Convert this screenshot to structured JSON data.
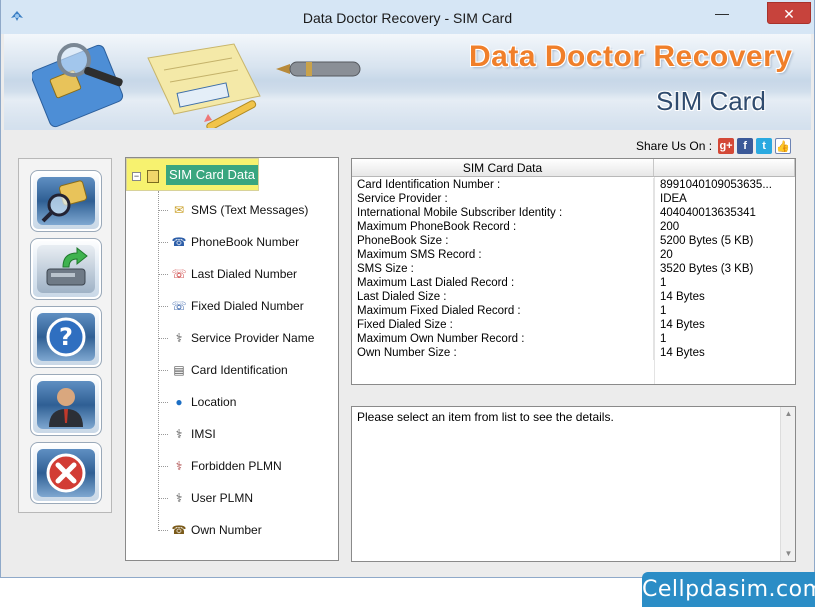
{
  "window": {
    "title": "Data Doctor Recovery - SIM Card",
    "min_glyph": "—",
    "close_glyph": "✕"
  },
  "banner": {
    "title": "Data Doctor Recovery",
    "subtitle": "SIM Card"
  },
  "share": {
    "label": "Share Us On :",
    "google": "g+",
    "facebook": "f",
    "twitter": "t",
    "like": "👍"
  },
  "sidebar": {
    "buttons": [
      {
        "icon": "search-sim-icon"
      },
      {
        "icon": "save-drive-icon"
      },
      {
        "icon": "help-icon"
      },
      {
        "icon": "user-icon"
      },
      {
        "icon": "exit-icon"
      }
    ]
  },
  "tree": {
    "root": "SIM Card Data",
    "items": [
      {
        "label": "SMS (Text Messages)",
        "icon": "envelope-icon",
        "glyph": "✉",
        "color": "#c79a1b"
      },
      {
        "label": "PhoneBook Number",
        "icon": "phonebook-icon",
        "glyph": "☎",
        "color": "#2d5ea8"
      },
      {
        "label": "Last Dialed Number",
        "icon": "phone-red-icon",
        "glyph": "☏",
        "color": "#c62828"
      },
      {
        "label": "Fixed Dialed Number",
        "icon": "phone-fixed-icon",
        "glyph": "☏",
        "color": "#1e4fa0"
      },
      {
        "label": "Service Provider Name",
        "icon": "tower-icon",
        "glyph": "⚕",
        "color": "#444444"
      },
      {
        "label": "Card Identification",
        "icon": "id-card-icon",
        "glyph": "▤",
        "color": "#555555"
      },
      {
        "label": "Location",
        "icon": "globe-icon",
        "glyph": "●",
        "color": "#1d6fc4"
      },
      {
        "label": "IMSI",
        "icon": "antenna-icon",
        "glyph": "⚕",
        "color": "#444444"
      },
      {
        "label": "Forbidden PLMN",
        "icon": "antenna-forbidden-icon",
        "glyph": "⚕",
        "color": "#a33333"
      },
      {
        "label": "User PLMN",
        "icon": "antenna-user-icon",
        "glyph": "⚕",
        "color": "#444444"
      },
      {
        "label": "Own Number",
        "icon": "own-number-icon",
        "glyph": "☎",
        "color": "#7a5a1a"
      }
    ]
  },
  "table": {
    "header": "SIM Card Data",
    "rows": [
      {
        "label": "Card Identification Number :",
        "value": "8991040109053635..."
      },
      {
        "label": "Service Provider :",
        "value": "IDEA"
      },
      {
        "label": "International Mobile Subscriber Identity :",
        "value": "404040013635341"
      },
      {
        "label": "Maximum PhoneBook Record :",
        "value": "200"
      },
      {
        "label": "PhoneBook Size :",
        "value": "5200 Bytes (5 KB)"
      },
      {
        "label": "Maximum SMS Record :",
        "value": "20"
      },
      {
        "label": "SMS Size :",
        "value": "3520 Bytes (3 KB)"
      },
      {
        "label": "Maximum Last Dialed Record :",
        "value": "1"
      },
      {
        "label": "Last Dialed Size :",
        "value": "14 Bytes"
      },
      {
        "label": "Maximum Fixed Dialed Record :",
        "value": "1"
      },
      {
        "label": "Fixed Dialed Size :",
        "value": "14 Bytes"
      },
      {
        "label": "Maximum Own Number Record :",
        "value": "1"
      },
      {
        "label": "Own Number Size :",
        "value": "14 Bytes"
      }
    ]
  },
  "details": {
    "message": "Please select an item from list to see the details."
  },
  "footer": {
    "brand": "Cellpdasim.com"
  }
}
